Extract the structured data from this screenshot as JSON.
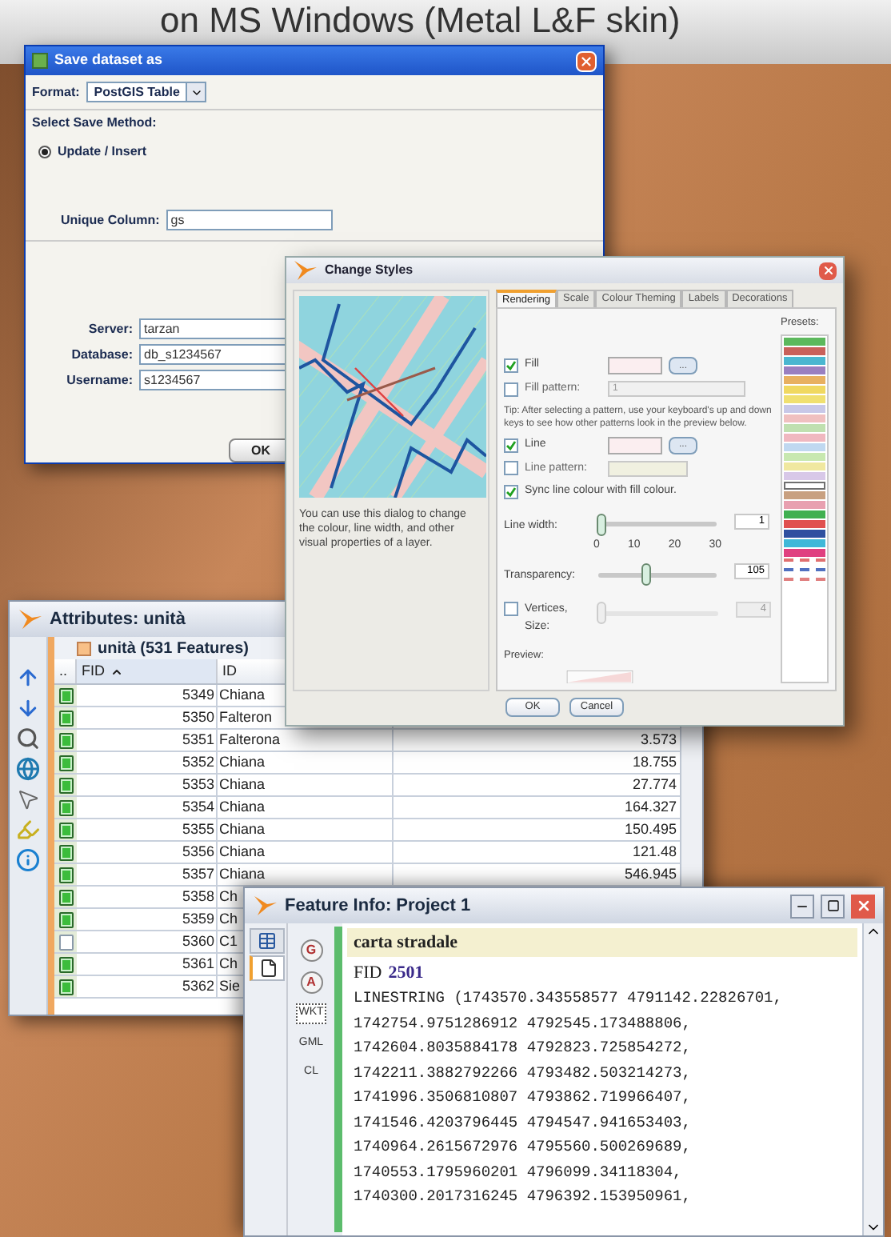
{
  "heading": "on MS Windows (Metal L&F skin)",
  "save_dialog": {
    "title": "Save dataset as",
    "format_label": "Format:",
    "format_value": "PostGIS Table",
    "method_group": "Select Save Method:",
    "methods": [
      {
        "label": "Update / Insert",
        "selected": true
      }
    ],
    "unique_column": {
      "label": "Unique Column:",
      "value": "gs"
    },
    "connection": [
      {
        "label": "Server:",
        "value": "tarzan"
      },
      {
        "label": "Database:",
        "value": "db_s1234567"
      },
      {
        "label": "Username:",
        "value": "s1234567"
      }
    ],
    "ok": "OK"
  },
  "styles_dialog": {
    "title": "Change Styles",
    "description": "You can use this dialog to change the colour, line width, and other visual properties of a layer.",
    "tabs": [
      {
        "label": "Rendering",
        "selected": true
      },
      {
        "label": "Scale",
        "selected": false
      },
      {
        "label": "Colour Theming",
        "selected": false
      },
      {
        "label": "Labels",
        "selected": false
      },
      {
        "label": "Decorations",
        "selected": false
      }
    ],
    "fill": {
      "label": "Fill",
      "checked": true,
      "button": "..."
    },
    "fill_pattern": {
      "label": "Fill pattern:",
      "checked": false,
      "value": "1"
    },
    "tip": "Tip: After selecting a pattern, use your keyboard's up and down keys to see how other patterns look in the preview below.",
    "line": {
      "label": "Line",
      "checked": true,
      "button": "..."
    },
    "line_pattern": {
      "label": "Line pattern:",
      "checked": false
    },
    "sync": {
      "label": "Sync line colour with fill colour.",
      "checked": true
    },
    "line_width": {
      "label": "Line width:",
      "level": 0.03,
      "ticks": [
        "0",
        "10",
        "20",
        "30"
      ],
      "value": "1"
    },
    "transparency": {
      "label": "Transparency:",
      "level": 0.4,
      "value": "105"
    },
    "vertices": {
      "label": "Vertices, Size:",
      "checked": false,
      "level": 0.02,
      "value": "4"
    },
    "preview_label": "Preview:",
    "presets_label": "Presets:",
    "presets": [
      {
        "kind": "solid",
        "color": "#5cb85c"
      },
      {
        "kind": "solid",
        "color": "#c9605a"
      },
      {
        "kind": "solid",
        "color": "#4ab6d0"
      },
      {
        "kind": "solid",
        "color": "#9a7fc0"
      },
      {
        "kind": "solid",
        "color": "#e8b060"
      },
      {
        "kind": "solid",
        "color": "#f0d860"
      },
      {
        "kind": "solid",
        "color": "#f0e070"
      },
      {
        "kind": "solid",
        "color": "#c8c8e8"
      },
      {
        "kind": "solid",
        "color": "#f0c0c0"
      },
      {
        "kind": "solid",
        "color": "#c0e0b0"
      },
      {
        "kind": "solid",
        "color": "#f0b8c0"
      },
      {
        "kind": "solid",
        "color": "#c0d8f0"
      },
      {
        "kind": "solid",
        "color": "#c8e8b0"
      },
      {
        "kind": "solid",
        "color": "#f0e8a0"
      },
      {
        "kind": "solid",
        "color": "#d8c8e8"
      },
      {
        "kind": "outline",
        "color": "#707070"
      },
      {
        "kind": "solid",
        "color": "#c8a080"
      },
      {
        "kind": "solid",
        "color": "#e8a0b0"
      },
      {
        "kind": "solid",
        "color": "#40b050"
      },
      {
        "kind": "solid",
        "color": "#e05050"
      },
      {
        "kind": "solid",
        "color": "#3050a0"
      },
      {
        "kind": "solid",
        "color": "#40b8d8"
      },
      {
        "kind": "solid",
        "color": "#e04080"
      },
      {
        "kind": "pattern",
        "color": "#e07070"
      },
      {
        "kind": "pattern",
        "color": "#5070c0"
      },
      {
        "kind": "pattern",
        "color": "#e08080"
      }
    ],
    "buttons": [
      "OK",
      "Cancel"
    ]
  },
  "attributes": {
    "title": "Attributes: unità",
    "layer": "unità (531 Features)",
    "columns": [
      {
        "label": "..",
        "sorted": false
      },
      {
        "label": "FID",
        "sorted": true
      },
      {
        "label": "ID",
        "sorted": false
      }
    ],
    "rows": [
      {
        "checked": true,
        "fid": "5349",
        "id": "Chiana"
      },
      {
        "checked": true,
        "fid": "5350",
        "id": "Falteron"
      },
      {
        "checked": true,
        "fid": "5351",
        "id": "Falterona",
        "value": "3.573"
      },
      {
        "checked": true,
        "fid": "5352",
        "id": "Chiana",
        "value": "18.755"
      },
      {
        "checked": true,
        "fid": "5353",
        "id": "Chiana",
        "value": "27.774"
      },
      {
        "checked": true,
        "fid": "5354",
        "id": "Chiana",
        "value": "164.327"
      },
      {
        "checked": true,
        "fid": "5355",
        "id": "Chiana",
        "value": "150.495"
      },
      {
        "checked": true,
        "fid": "5356",
        "id": "Chiana",
        "value": "121.48"
      },
      {
        "checked": true,
        "fid": "5357",
        "id": "Chiana",
        "value": "546.945"
      },
      {
        "checked": true,
        "fid": "5358",
        "id": "Ch"
      },
      {
        "checked": true,
        "fid": "5359",
        "id": "Ch"
      },
      {
        "checked": false,
        "fid": "5360",
        "id": "C1"
      },
      {
        "checked": true,
        "fid": "5361",
        "id": "Ch"
      },
      {
        "checked": true,
        "fid": "5362",
        "id": "Sie"
      }
    ]
  },
  "feature_info": {
    "title": "Feature Info: Project 1",
    "tabs": [
      {
        "kind": "table",
        "selected": false
      },
      {
        "kind": "document",
        "selected": true
      }
    ],
    "formats": [
      {
        "kind": "round",
        "label": "G",
        "selected": false
      },
      {
        "kind": "round",
        "label": "A",
        "selected": false
      },
      {
        "kind": "text",
        "label": "WKT",
        "selected": true
      },
      {
        "kind": "text",
        "label": "GML",
        "selected": false
      },
      {
        "kind": "text",
        "label": "CL",
        "selected": false
      }
    ],
    "layer": "carta stradale",
    "fid_label": "FID",
    "fid": "2501",
    "geometry": [
      "LINESTRING (1743570.343558577 4791142.22826701,",
      "1742754.9751286912 4792545.173488806,",
      "1742604.8035884178 4792823.725854272,",
      "1742211.3882792266 4793482.503214273,",
      "1741996.3506810807 4793862.719966407,",
      "1741546.4203796445 4794547.941653403,",
      "1740964.2615672976 4795560.500269689,",
      "1740553.1795960201 4796099.34118304,",
      "1740300.2017316245 4796392.153950961,"
    ]
  }
}
